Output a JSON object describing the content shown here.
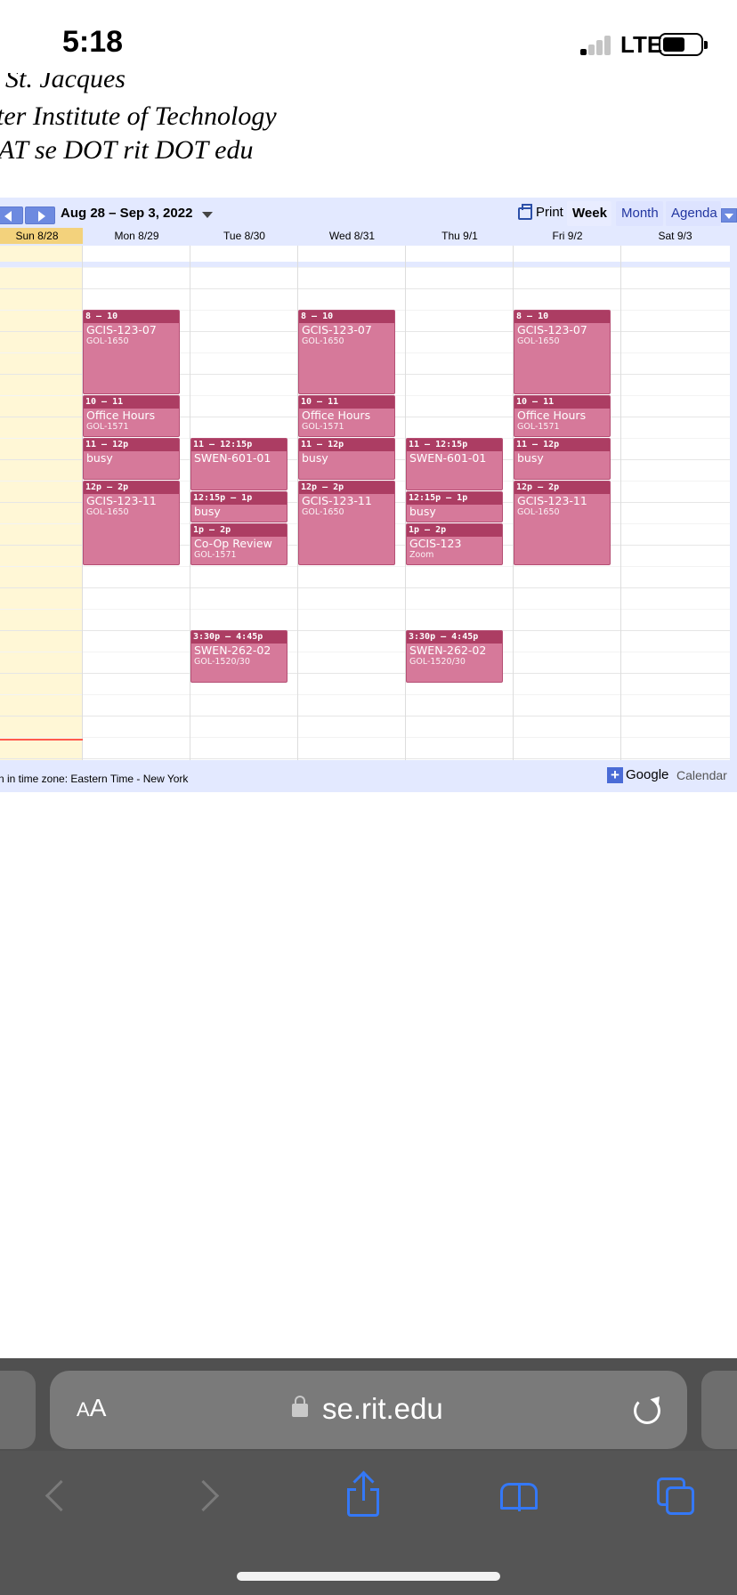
{
  "status_bar": {
    "time": "5:18",
    "network": "LTE"
  },
  "page": {
    "lines": [
      "St. Jacques",
      "ter Institute of Technology",
      "AT se DOT rit DOT edu",
      "."
    ]
  },
  "calendar": {
    "date_range": "Aug 28 – Sep 3, 2022",
    "print_label": "Print",
    "view_tabs": {
      "week": "Week",
      "month": "Month",
      "agenda": "Agenda"
    },
    "days": [
      {
        "label": "Sun 8/28",
        "today": true
      },
      {
        "label": "Mon 8/29"
      },
      {
        "label": "Tue 8/30"
      },
      {
        "label": "Wed 8/31"
      },
      {
        "label": "Thu 9/1"
      },
      {
        "label": "Fri 9/2"
      },
      {
        "label": "Sat 9/3"
      }
    ],
    "events": [
      {
        "day": 1,
        "time": "8 – 10",
        "title": "GCIS-123-07",
        "location": "GOL-1650",
        "start": 8,
        "end": 10
      },
      {
        "day": 1,
        "time": "10 – 11",
        "title": "Office Hours",
        "location": "GOL-1571",
        "start": 10,
        "end": 11
      },
      {
        "day": 1,
        "time": "11 – 12p",
        "title": "busy",
        "location": "",
        "start": 11,
        "end": 12
      },
      {
        "day": 1,
        "time": "12p – 2p",
        "title": "GCIS-123-11",
        "location": "GOL-1650",
        "start": 12,
        "end": 14
      },
      {
        "day": 2,
        "time": "11 – 12:15p",
        "title": "SWEN-601-01",
        "location": "",
        "start": 11,
        "end": 12.25
      },
      {
        "day": 2,
        "time": "12:15p – 1p",
        "title": "busy",
        "location": "",
        "start": 12.25,
        "end": 13
      },
      {
        "day": 2,
        "time": "1p – 2p",
        "title": "Co-Op Review",
        "location": "GOL-1571",
        "start": 13,
        "end": 14
      },
      {
        "day": 2,
        "time": "3:30p – 4:45p",
        "title": "SWEN-262-02",
        "location": "GOL-1520/30",
        "start": 15.5,
        "end": 16.75
      },
      {
        "day": 3,
        "time": "8 – 10",
        "title": "GCIS-123-07",
        "location": "GOL-1650",
        "start": 8,
        "end": 10
      },
      {
        "day": 3,
        "time": "10 – 11",
        "title": "Office Hours",
        "location": "GOL-1571",
        "start": 10,
        "end": 11
      },
      {
        "day": 3,
        "time": "11 – 12p",
        "title": "busy",
        "location": "",
        "start": 11,
        "end": 12
      },
      {
        "day": 3,
        "time": "12p – 2p",
        "title": "GCIS-123-11",
        "location": "GOL-1650",
        "start": 12,
        "end": 14
      },
      {
        "day": 4,
        "time": "11 – 12:15p",
        "title": "SWEN-601-01",
        "location": "",
        "start": 11,
        "end": 12.25
      },
      {
        "day": 4,
        "time": "12:15p – 1p",
        "title": "busy",
        "location": "",
        "start": 12.25,
        "end": 13
      },
      {
        "day": 4,
        "time": "1p – 2p",
        "title": "GCIS-123",
        "location": "Zoom",
        "start": 13,
        "end": 14
      },
      {
        "day": 4,
        "time": "3:30p – 4:45p",
        "title": "SWEN-262-02",
        "location": "GOL-1520/30",
        "start": 15.5,
        "end": 16.75
      },
      {
        "day": 5,
        "time": "8 – 10",
        "title": "GCIS-123-07",
        "location": "GOL-1650",
        "start": 8,
        "end": 10
      },
      {
        "day": 5,
        "time": "10 – 11",
        "title": "Office Hours",
        "location": "GOL-1571",
        "start": 10,
        "end": 11
      },
      {
        "day": 5,
        "time": "11 – 12p",
        "title": "busy",
        "location": "",
        "start": 11,
        "end": 12
      },
      {
        "day": 5,
        "time": "12p – 2p",
        "title": "GCIS-123-11",
        "location": "GOL-1650",
        "start": 12,
        "end": 14
      }
    ],
    "timezone_note": "n in time zone: Eastern Time - New York",
    "badge": {
      "plus": "+",
      "google": "Google",
      "calendar": "Calendar"
    },
    "colors": {
      "event": "#d6799a",
      "event_header": "#ac3d63",
      "today": "#f3d27c",
      "accent": "#6d8ae0"
    }
  },
  "safari": {
    "aa_label": "AA",
    "url": "se.rit.edu",
    "icons": [
      "back-icon",
      "forward-icon",
      "share-icon",
      "bookmarks-icon",
      "tabs-icon"
    ]
  }
}
